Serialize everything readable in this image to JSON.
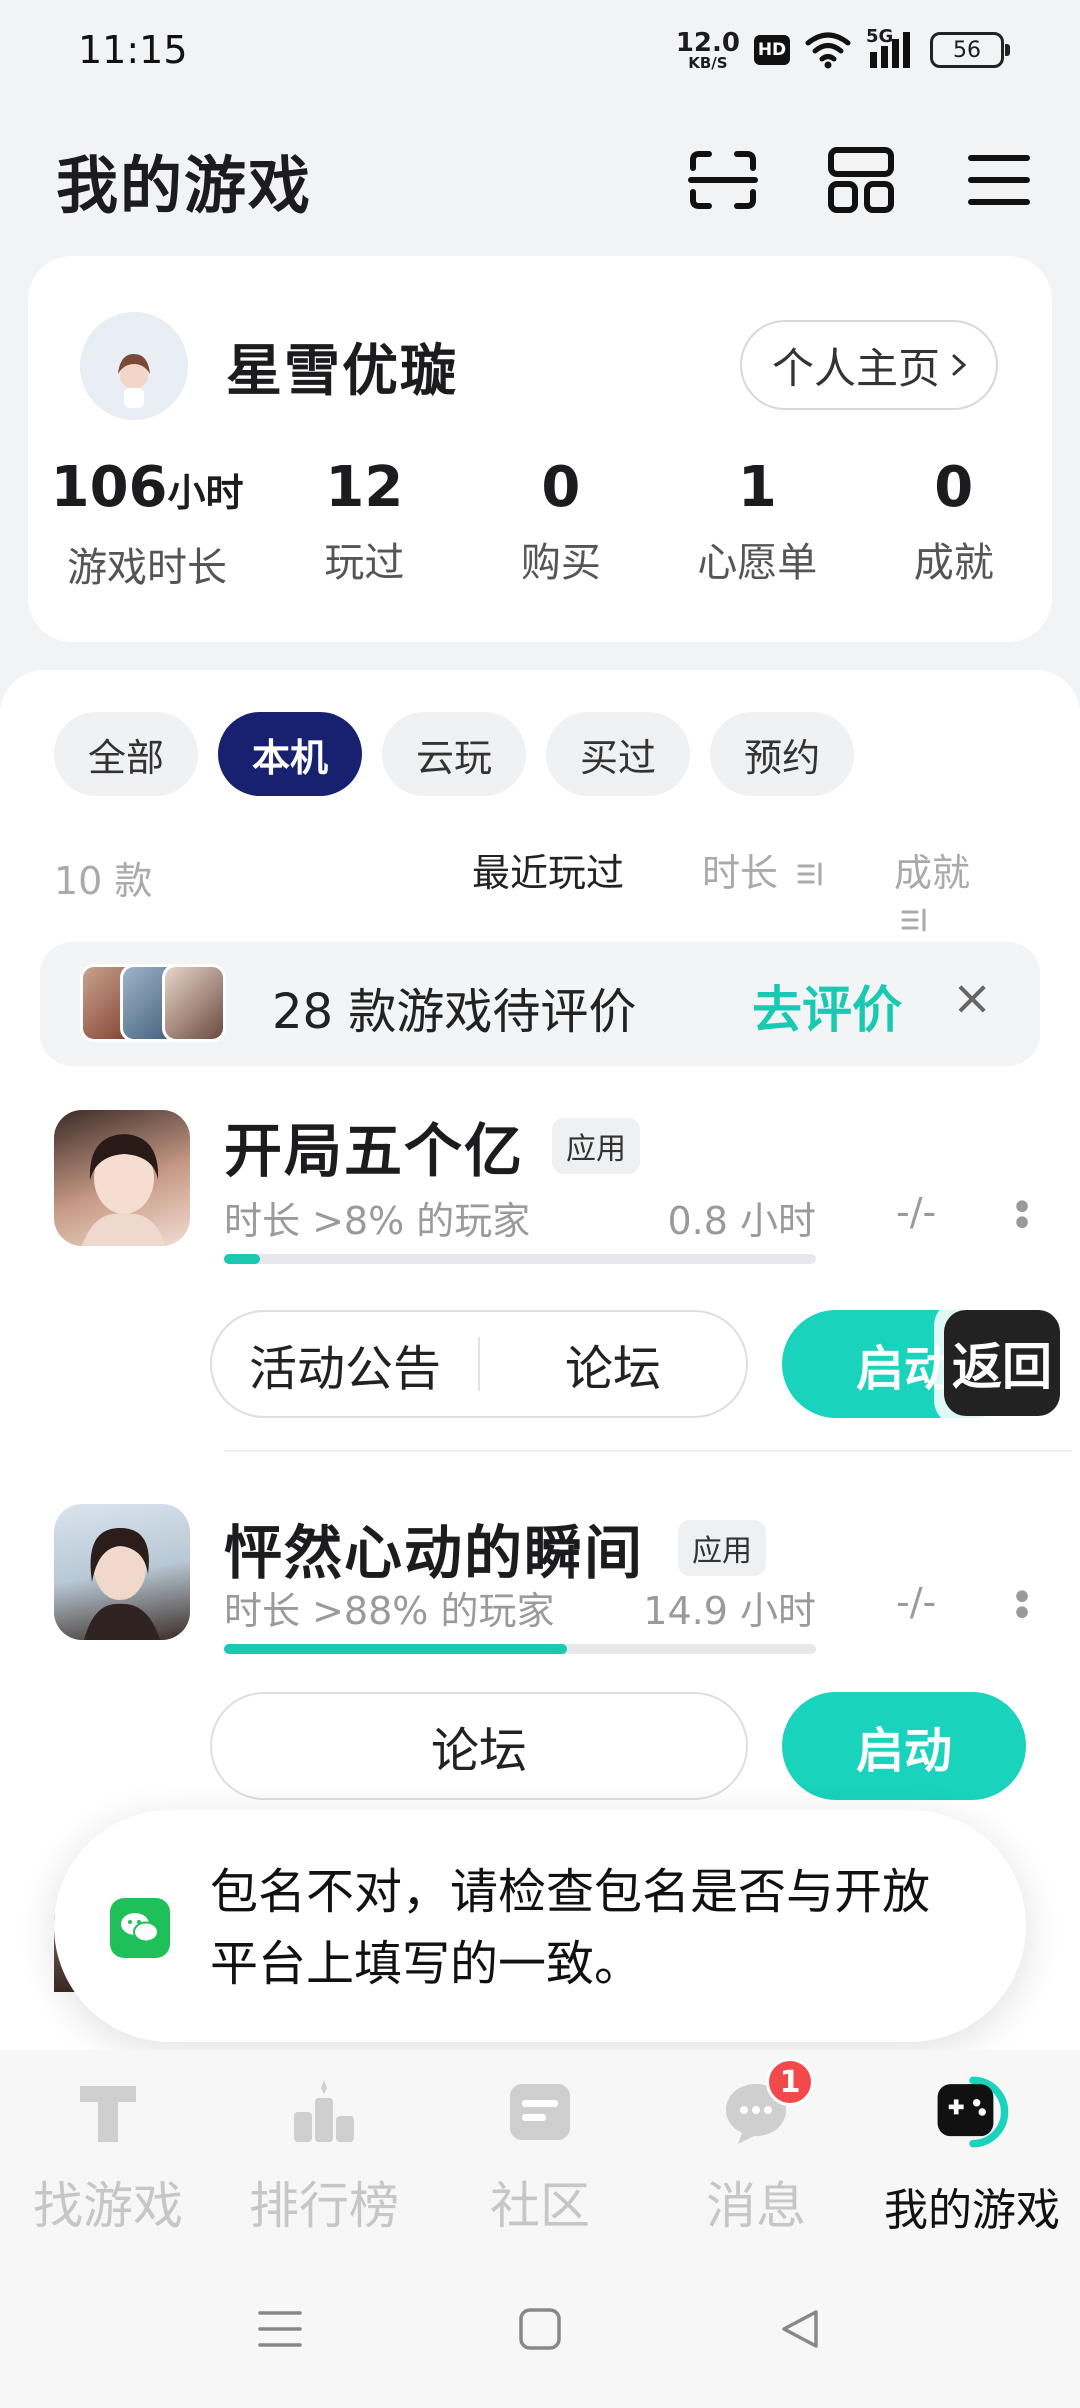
{
  "status_bar": {
    "time": "11:15",
    "net_speed_value": "12.0",
    "net_speed_unit": "KB/S",
    "hd": "HD",
    "network": "5G",
    "battery": "56"
  },
  "header": {
    "title": "我的游戏"
  },
  "profile": {
    "username": "星雪优璇",
    "homepage_button": "个人主页",
    "stats": [
      {
        "value": "106",
        "unit": "小时",
        "label": "游戏时长"
      },
      {
        "value": "12",
        "unit": "",
        "label": "玩过"
      },
      {
        "value": "0",
        "unit": "",
        "label": "购买"
      },
      {
        "value": "1",
        "unit": "",
        "label": "心愿单"
      },
      {
        "value": "0",
        "unit": "",
        "label": "成就"
      }
    ]
  },
  "filters": [
    {
      "label": "全部",
      "active": false
    },
    {
      "label": "本机",
      "active": true
    },
    {
      "label": "云玩",
      "active": false
    },
    {
      "label": "买过",
      "active": false
    },
    {
      "label": "预约",
      "active": false
    }
  ],
  "sort": {
    "count": "10 款",
    "recent": "最近玩过",
    "duration": "时长",
    "achievements": "成就"
  },
  "review_banner": {
    "text": "28 款游戏待评价",
    "action": "去评价",
    "close": "×"
  },
  "games": [
    {
      "title": "开局五个亿",
      "tag": "应用",
      "meta": "时长 >8% 的玩家",
      "hours": "0.8 小时",
      "achievement": "-/-",
      "progress": 0.06,
      "buttons": [
        "活动公告",
        "论坛"
      ],
      "start": "启动"
    },
    {
      "title": "怦然心动的瞬间",
      "tag": "应用",
      "meta": "时长 >88% 的玩家",
      "hours": "14.9 小时",
      "achievement": "-/-",
      "progress": 0.58,
      "buttons": [
        "论坛"
      ],
      "start": "启动"
    }
  ],
  "back_button": "返回",
  "toast": {
    "text": "包名不对，请检查包名是否与开放平台上填写的一致。"
  },
  "bottom_nav": [
    {
      "label": "找游戏",
      "icon": "find-games-icon",
      "active": false
    },
    {
      "label": "排行榜",
      "icon": "ranking-icon",
      "active": false
    },
    {
      "label": "社区",
      "icon": "community-icon",
      "active": false
    },
    {
      "label": "消息",
      "icon": "message-icon",
      "active": false,
      "badge": "1"
    },
    {
      "label": "我的游戏",
      "icon": "my-games-icon",
      "active": true
    }
  ],
  "colors": {
    "accent": "#19d3bd",
    "active_chip": "#182070",
    "badge": "#f24a4a"
  }
}
